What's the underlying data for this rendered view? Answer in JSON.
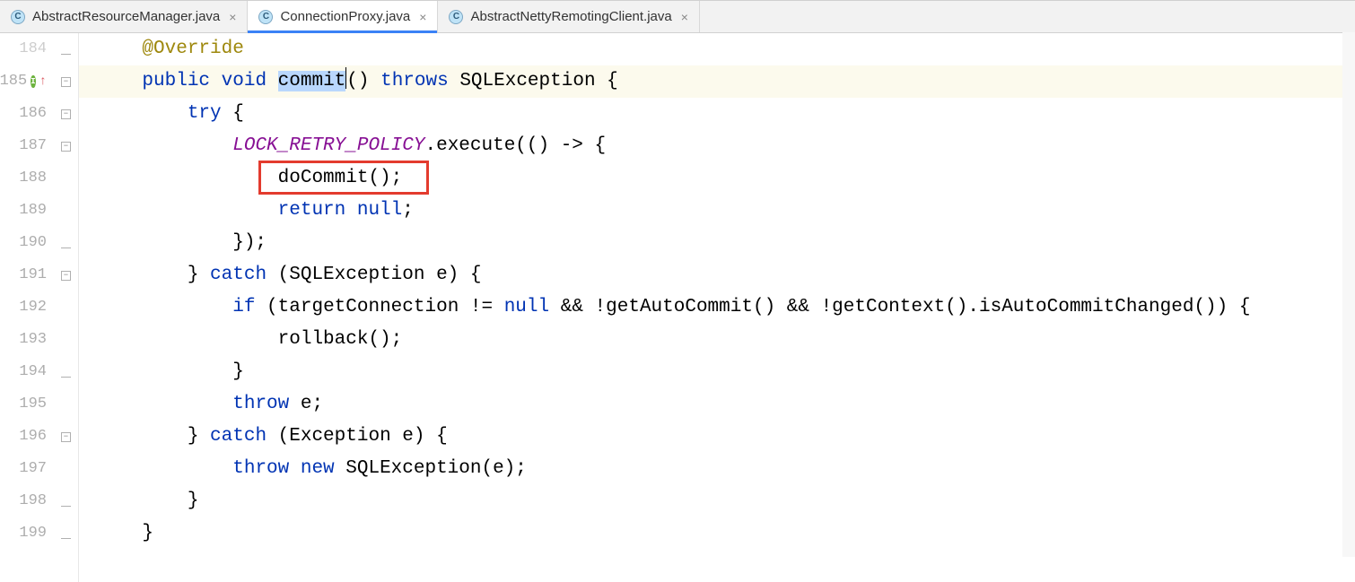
{
  "tabs": [
    {
      "label": "AbstractResourceManager.java",
      "icon": "C",
      "active": false
    },
    {
      "label": "ConnectionProxy.java",
      "icon": "C",
      "active": true
    },
    {
      "label": "AbstractNettyRemotingClient.java",
      "icon": "C",
      "active": false
    }
  ],
  "lines": [
    {
      "num": "184",
      "fold": "up",
      "html": "    <span class='ann'>@Override</span>",
      "dim": true
    },
    {
      "num": "185",
      "marker": true,
      "hl": true,
      "fold": "minus",
      "html": "    <span class='kw'>public void</span> <span class='sel'>commit</span><span class='cursor'></span>() <span class='kw'>throws</span> SQLException {"
    },
    {
      "num": "186",
      "fold": "minus",
      "html": "        <span class='kw'>try</span> {"
    },
    {
      "num": "187",
      "fold": "minus",
      "html": "            <span class='str-const'>LOCK_RETRY_POLICY</span>.execute(() -> {"
    },
    {
      "num": "188",
      "html": "                doCommit();",
      "redbox": true
    },
    {
      "num": "189",
      "html": "                <span class='kw'>return null</span>;"
    },
    {
      "num": "190",
      "fold": "up",
      "html": "            });"
    },
    {
      "num": "191",
      "fold": "upminus",
      "html": "        } <span class='kw'>catch</span> (SQLException e) {"
    },
    {
      "num": "192",
      "html": "            <span class='kw'>if</span> (targetConnection != <span class='kw'>null</span> && !getAutoCommit() && !getContext().isAutoCommitChanged()) {"
    },
    {
      "num": "193",
      "html": "                rollback();"
    },
    {
      "num": "194",
      "fold": "up",
      "html": "            }"
    },
    {
      "num": "195",
      "html": "            <span class='kw'>throw</span> e;"
    },
    {
      "num": "196",
      "fold": "upminus",
      "html": "        } <span class='kw'>catch</span> (Exception e) {"
    },
    {
      "num": "197",
      "html": "            <span class='kw'>throw new</span> SQLException(e);"
    },
    {
      "num": "198",
      "fold": "up",
      "html": "        }"
    },
    {
      "num": "199",
      "fold": "up",
      "html": "    }"
    },
    {
      "num": "",
      "html": ""
    }
  ]
}
